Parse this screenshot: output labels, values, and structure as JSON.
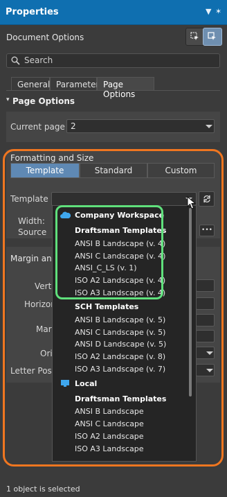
{
  "window": {
    "title": "Properties",
    "pin_glyph": "▼",
    "pin_glyph2": "✶",
    "close_glyph": "✕"
  },
  "header": {
    "doc_options": "Document Options",
    "icons": [
      "filter-select-icon",
      "filter-pointer-icon"
    ]
  },
  "search": {
    "label": "Search",
    "icon": "search-icon"
  },
  "tabs": [
    {
      "label": "General"
    },
    {
      "label": "Parameters"
    },
    {
      "label": "Page Options"
    }
  ],
  "page_options": {
    "section_label": "Page Options",
    "current_page_label": "Current page",
    "current_page_value": "2"
  },
  "formatting": {
    "section_label": "Formatting and Size",
    "modes": [
      "Template",
      "Standard",
      "Custom"
    ],
    "template_label": "Template",
    "width_label": "Width:",
    "source_label": "Source",
    "source_btn": "•••"
  },
  "margin": {
    "section_label": "Margin and",
    "vert_label": "Vert",
    "horiz_label": "Horizon",
    "mar_label": "Mar",
    "ori_label": "Ori",
    "letter_pos_label": "Letter Posit"
  },
  "dropdown": {
    "company_workspace": "Company Workspace",
    "draftsman_templates": "Draftsman Templates",
    "draftsman_items": [
      "ANSI B Landscape (v. 4)",
      "ANSI C Landscape (v. 4)",
      "ANSI_C_LS (v. 1)",
      "ISO A2 Landscape (v. 4)",
      "ISO A3 Landscape (v. 4)"
    ],
    "sch_templates": "SCH Templates",
    "sch_items": [
      "ANSI B Landscape (v. 5)",
      "ANSI C Landscape (v. 5)",
      "ANSI D Landscape (v. 5)",
      "ISO A2 Landscape (v. 8)",
      "ISO A3 Landscape (v. 7)"
    ],
    "local": "Local",
    "local_draftsman_templates": "Draftsman Templates",
    "local_items": [
      "ANSI B Landscape",
      "ANSI C Landscape",
      "ISO A2 Landscape",
      "ISO A3 Landscape"
    ]
  },
  "status": {
    "text": "1 object is selected"
  },
  "colors": {
    "title_bar": "#0f6fb0",
    "highlight_orange": "#f07620",
    "highlight_green": "#5fe07c",
    "segment_selected": "#5f89b4"
  }
}
